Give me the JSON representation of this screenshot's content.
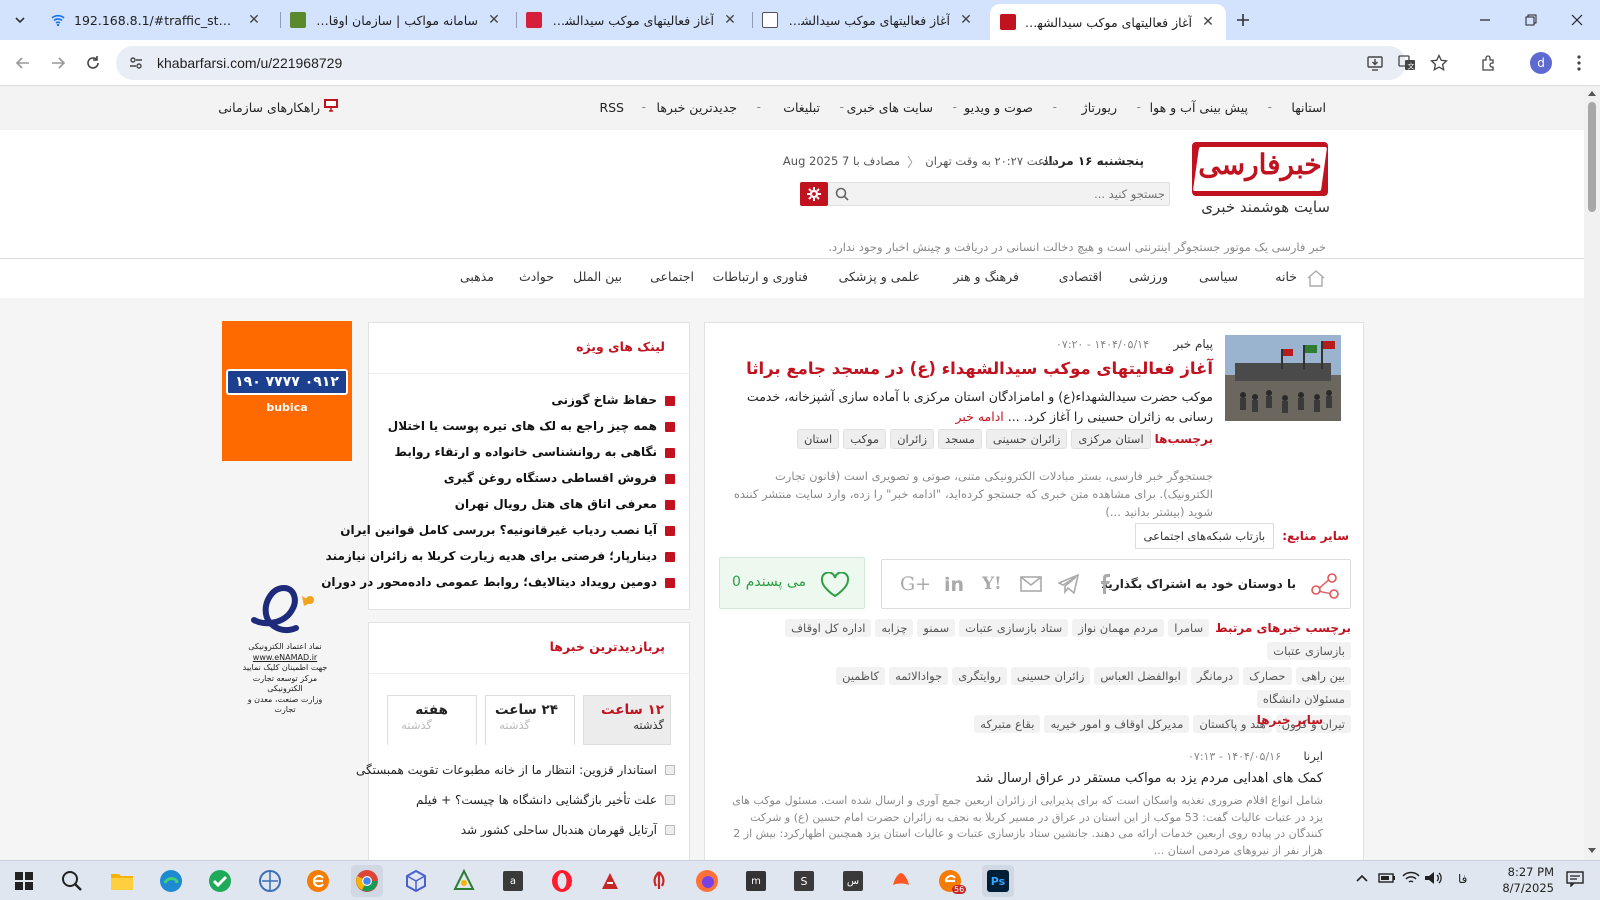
{
  "browser": {
    "tabs": [
      {
        "title": "192.168.8.1/#traffic_statistics",
        "active": false
      },
      {
        "title": "سامانه مواکب | سازمان اوقاف و",
        "active": false
      },
      {
        "title": "آغاز فعالیتهای موکب سیدالشهدا",
        "active": false
      },
      {
        "title": "آغاز فعالیتهای موکب سیدالشهداء",
        "active": false
      },
      {
        "title": "آغاز فعالیتهای موکب سیدالشهداء",
        "active": true
      }
    ],
    "url": "khabarfarsi.com/u/221968729",
    "profile_initial": "d"
  },
  "site": {
    "top_links": [
      "استانها",
      "پیش بینی آب و هوا",
      "ریورتاژ",
      "صوت و ویدیو",
      "سایت های خبری",
      "تبلیغات",
      "جدیدترین خبرها",
      "RSS"
    ],
    "org_solutions": "راهکارهای سازمانی",
    "logo_text": "خبرفارسی",
    "logo_tagline": "سایت هوشمند خبری",
    "date_day": "پنجشنبه ۱۶ مرداد",
    "date_time": "ساعت ۲۰:۲۷ به وقت تهران",
    "date_greg": "مصادف با 7 Aug 2025",
    "search_placeholder": "جستجو کنید ...",
    "disclaimer": "خبر فارسی یک موتور جستجوگر اینترنتی است و هیچ دخالت انسانی در دریافت و چینش اخبار وجود ندارد.",
    "categories": [
      "خانه",
      "سیاسی",
      "ورزشی",
      "اقتصادی",
      "فرهنگ و هنر",
      "علمی و پزشکی",
      "فناوری و ارتباطات",
      "اجتماعی",
      "بین الملل",
      "حوادث",
      "مذهبی"
    ]
  },
  "article": {
    "source": "پیام خبر",
    "datetime": "۱۴۰۴/۰۵/۱۴ - ۰۷:۲۰",
    "title": "آغاز فعالیتهای موکب سیدالشهداء (ع) در مسجد جامع براثا",
    "summary": "موکب حضرت سیدالشهداء(ع) و امامزادگان استان مرکزی با آماده سازی آشپزخانه، خدمت رسانی به زائران حسینی را آغاز کرد. ...",
    "read_more": "ادامه خبر",
    "tags_label": "برچسب‌ها",
    "tags": [
      "استان مرکزی",
      "زائران حسینی",
      "مسجد",
      "زائران",
      "موکب",
      "استان"
    ],
    "legal_notice": "جستجوگر خبر فارسی، بستر مبادلات الکترونیکی متنی، صوتی و تصویری است (قانون تجارت الکترونیک). برای مشاهده متن خبری که جستجو کرده‌اید، \"ادامه خبر\" را زده، وارد سایت منتشر کننده شوید (بیشتر بدانید ...)",
    "other_sources_label": "سایر منابع:",
    "other_sources": [
      "بازتاب شبکه‌های اجتماعی"
    ],
    "share_label": "با دوستان خود به اشتراک بگذارید",
    "share_icons": [
      "facebook-icon",
      "telegram-icon",
      "email-icon",
      "yahoo-icon",
      "linkedin-icon",
      "google-plus-icon"
    ],
    "like_label": "می پسندم",
    "like_count": "0",
    "related_label": "برچسب خبرهای مرتبط",
    "related_tags": [
      [
        "سامرا",
        "مردم مهمان نواز",
        "ستاد بازسازی عتبات",
        "سمنو",
        "چزابه",
        "اداره کل اوقاف",
        "بازسازی عتبات"
      ],
      [
        "بین راهی",
        "حصارک",
        "درمانگر",
        "ابوالفضل العباس",
        "زائران حسینی",
        "روایتگری",
        "جوادالائمه",
        "کاظمین",
        "مسئولان دانشگاه"
      ],
      [
        "تیران و کرون",
        "هند و پاکستان",
        "مدیرکل اوقاف و امور خیریه",
        "بقاع متبرکه"
      ]
    ],
    "other_news_label": "سایر خبرها"
  },
  "news2": {
    "source": "ایرنا",
    "datetime": "۱۴۰۴/۰۵/۱۶ - ۰۷:۱۳",
    "title": "کمک های اهدایی مردم یزد به مواکب مستقر در عراق ارسال شد",
    "body": "شامل انواع اقلام ضروری تغذیه واسکان است که برای پذیرایی از زائران اربعین جمع آوری و ارسال شده است. مسئول موکب های یزد در عتبات عالیات گفت: 53 موکب از این استان در عراق در مسیر کربلا به نجف به زائران حضرت امام حسین (ع) و شرکت کنندگان در پیاده روی اربعین خدمات ارائه می دهند. جانشین ستاد بازسازی عتبات و عالیات استان یزد همچنین اظهارکرد: بیش از 2 هزار نفر از نیروهای مردمی استان ..."
  },
  "sidebar": {
    "special_links_title": "لینک های ویژه",
    "special_links": [
      "حفاظ شاخ گوزنی",
      "همه چیز راجع به لک های تیره پوست یا اختلال",
      "نگاهی به روانشناسی خانواده و ارتقاء روابط",
      "فروش اقساطی دستگاه روغن گیری",
      "معرفی اتاق های هتل رویال تهران",
      "آیا نصب ردیاب غیرقانونیه؟ بررسی کامل قوانین ایران",
      "دینارپار؛ فرصتی برای هدیه زیارت کربلا به زائران نیازمند",
      "دومین رویداد دیتالایف؛ روابط عمومی داده‌محور در دوران"
    ],
    "popular_title": "پربازدیدترین خبرها",
    "popular_tabs": [
      {
        "main": "۱۲ ساعت",
        "sub": "گذشته",
        "active": true
      },
      {
        "main": "۲۴ ساعت",
        "sub": "گذشته",
        "active": false
      },
      {
        "main": "هفته",
        "sub": "گذشته",
        "active": false
      }
    ],
    "popular_items": [
      "استاندار قزوین: انتظار ما از خانه مطبوعات تقویت همبستگی",
      "علت تأخیر بازگشایی دانشگاه ها چیست؟ + فیلم",
      "آرتایل قهرمان هندبال ساحلی کشور شد"
    ]
  },
  "ad": {
    "phone": "۰۹۱۲ ۷۷۷۷ ۱۹۰",
    "brand": "bubica"
  },
  "enamad": {
    "lines": [
      "نماد اعتماد الکترونیکی",
      "www.eNAMAD.ir",
      "جهت اطمینان کلیک نمایید",
      "مرکز توسعه تجارت الکترونیکی",
      "وزارت صنعت، معدن و تجارت"
    ]
  },
  "taskbar": {
    "apps": [
      "start-icon",
      "search-icon",
      "file-explorer-icon",
      "edge-icon",
      "security-icon",
      "network-app-icon",
      "browser-e-icon",
      "chrome-icon",
      "app-cube-icon",
      "app-tree-icon",
      "app-a-icon",
      "opera-icon",
      "app-redwhite-icon",
      "app-emblem-icon",
      "firefox-icon",
      "app-dark-icon",
      "app-s-icon",
      "app-m-icon",
      "app-bird-icon",
      "app-badge-icon",
      "photoshop-icon"
    ],
    "badge_count": "56",
    "language": "فا",
    "time": "8:27 PM",
    "date": "8/7/2025"
  },
  "colors": {
    "accent_red": "#c1121f",
    "tab_strip": "#d3e3fd",
    "ad_orange": "#ff6a00",
    "like_green": "#2e9e46"
  }
}
